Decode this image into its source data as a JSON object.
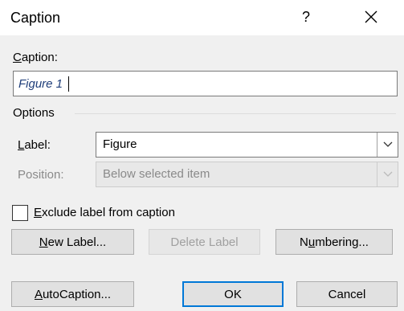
{
  "window": {
    "title": "Caption",
    "help_label": "?"
  },
  "caption": {
    "label_accel": "C",
    "label_rest": "aption:",
    "value": "Figure 1"
  },
  "options": {
    "group_label": "Options",
    "label_field": {
      "label_accel": "L",
      "label_rest": "abel:",
      "value": "Figure"
    },
    "position_field": {
      "label": "Position:",
      "value": "Below selected item"
    }
  },
  "exclude": {
    "accel": "E",
    "rest": "xclude label from caption",
    "checked": false
  },
  "buttons": {
    "new_label": {
      "accel": "N",
      "rest": "ew Label..."
    },
    "delete_label": "Delete Label",
    "numbering": {
      "pre": "N",
      "accel": "u",
      "rest": "mbering..."
    },
    "autocaption": {
      "accel": "A",
      "rest": "utoCaption..."
    },
    "ok": "OK",
    "cancel": "Cancel"
  },
  "colors": {
    "accent": "#0078d7",
    "input_text": "#1f3e7a"
  }
}
